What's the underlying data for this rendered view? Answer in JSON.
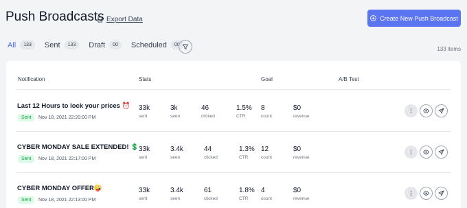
{
  "header": {
    "title": "Push Broadcasts",
    "export_label": "Export Data",
    "create_label": "Create New Push Broadcast"
  },
  "tabs": [
    {
      "label": "All",
      "count": "133"
    },
    {
      "label": "Sent",
      "count": "133"
    },
    {
      "label": "Draft",
      "count": "00"
    },
    {
      "label": "Scheduled",
      "count": "00"
    }
  ],
  "items_count": "133 items",
  "table": {
    "headers": {
      "notification": "Notification",
      "stats": "Stats",
      "goal": "Goal",
      "ab_test": "A/B Test"
    },
    "rows": [
      {
        "title": "Last 12 Hours to lock your prices ⏰",
        "status": "Sent",
        "date": "Nov 18, 2021 22:20:00 PM",
        "sent": "33k",
        "sent_label": "sent",
        "seen": "3k",
        "seen_label": "seen",
        "clicked": "46",
        "clicked_label": "clicked",
        "ctr": "1.5%",
        "ctr_label": "CTR",
        "count": "8",
        "count_label": "count",
        "revenue": "$0",
        "revenue_label": "revenue"
      },
      {
        "title": "CYBER MONDAY SALE EXTENDED! 💲",
        "status": "Sent",
        "date": "Nov 18, 2021 22:17:00 PM",
        "sent": "33k",
        "sent_label": "sent",
        "seen": "3.4k",
        "seen_label": "seen",
        "clicked": "44",
        "clicked_label": "clicked",
        "ctr": "1.3%",
        "ctr_label": "CTR",
        "count": "12",
        "count_label": "count",
        "revenue": "$0",
        "revenue_label": "revenue"
      },
      {
        "title": "CYBER MONDAY OFFER🤪",
        "status": "Sent",
        "date": "Nov 18, 2021 22:13:00 PM",
        "sent": "33k",
        "sent_label": "sent",
        "seen": "3.4k",
        "seen_label": "seen",
        "clicked": "61",
        "clicked_label": "clicked",
        "ctr": "1.8%",
        "ctr_label": "CTR",
        "count": "4",
        "count_label": "count",
        "revenue": "$0",
        "revenue_label": "revenue"
      }
    ]
  },
  "colors": {
    "accent": "#5b74f2",
    "sent_badge_bg": "#dcfce7",
    "sent_badge_text": "#16a34a"
  },
  "icons": [
    "export-icon",
    "plus-circle-icon",
    "filter-icon",
    "more-icon",
    "eye-icon",
    "send-icon"
  ]
}
